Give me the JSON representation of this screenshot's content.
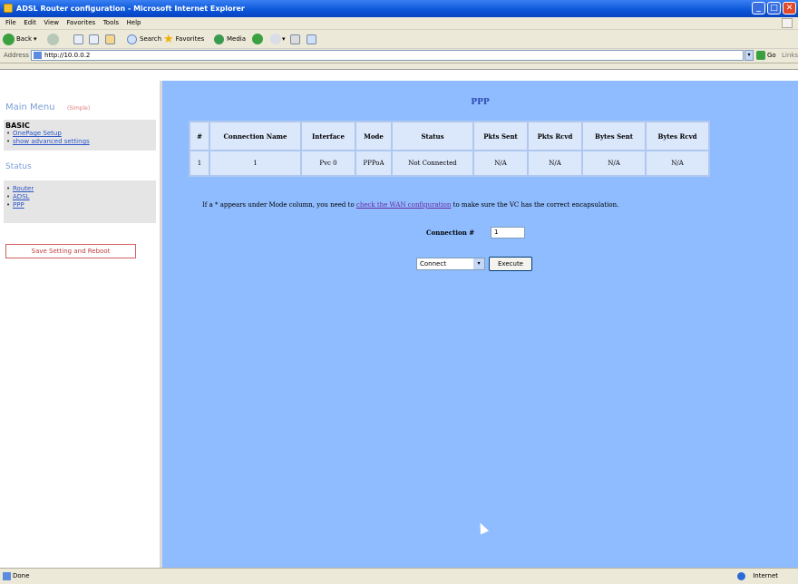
{
  "window": {
    "title": "ADSL Router configuration - Microsoft Internet Explorer",
    "minimize": "_",
    "maximize": "□",
    "close": "✕"
  },
  "menubar": [
    "File",
    "Edit",
    "View",
    "Favorites",
    "Tools",
    "Help"
  ],
  "toolbar": {
    "back": "Back",
    "search": "Search",
    "favorites": "Favorites",
    "media": "Media"
  },
  "addressbar": {
    "label": "Address",
    "url": "http://10.0.0.2",
    "go": "Go",
    "links": "Links"
  },
  "left_menu": {
    "title": "Main Menu",
    "simple": "(Simple)",
    "basic_header": "BASIC",
    "basic_items": [
      "OnePage Setup",
      "show advanced settings"
    ],
    "status_header": "Status",
    "status_items": [
      "Router",
      "ADSL",
      "PPP"
    ],
    "save_button": "Save Setting and Reboot"
  },
  "main": {
    "title": "PPP",
    "table": {
      "headers": [
        "#",
        "Connection Name",
        "Interface",
        "Mode",
        "Status",
        "Pkts Sent",
        "Pkts Rcvd",
        "Bytes Sent",
        "Bytes Rcvd"
      ],
      "rows": [
        [
          "1",
          "1",
          "Pvc 0",
          "PPPoA",
          "Not Connected",
          "N/A",
          "N/A",
          "N/A",
          "N/A"
        ]
      ]
    },
    "note_before": "If a * appears under Mode column, you need to",
    "note_link": "check the WAN configuration",
    "note_after": "to make sure the VC has the correct encapsulation.",
    "connection_label": "Connection #",
    "connection_value": "1",
    "action_selected": "Connect",
    "execute_button": "Execute"
  },
  "statusbar": {
    "left": "Done",
    "right": "Internet"
  },
  "colors": {
    "main_bg": "#8fbcff",
    "title_blue": "#2a4ab0",
    "link_blue": "#2b55c8"
  }
}
